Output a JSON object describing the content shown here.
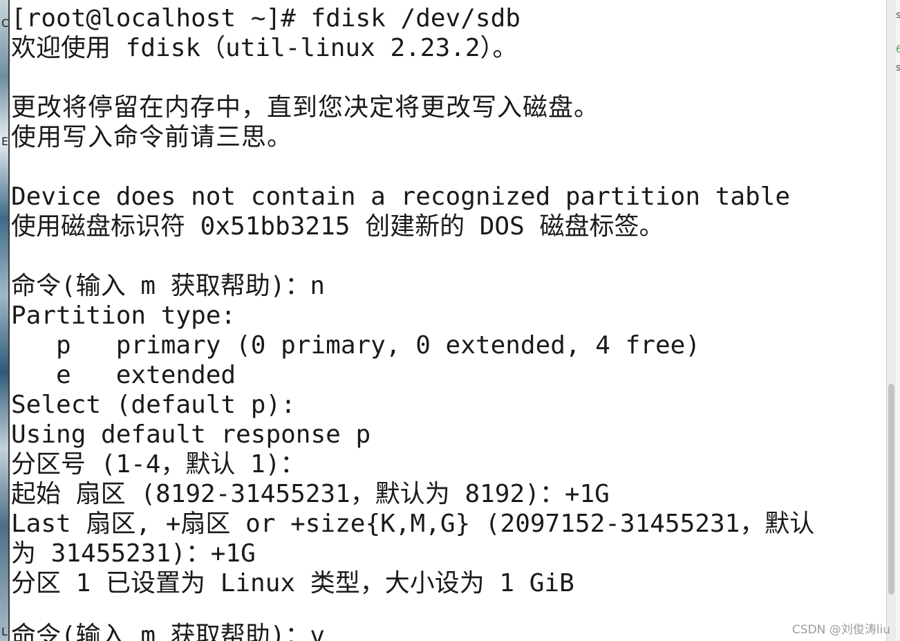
{
  "terminal": {
    "lines": [
      "[root@localhost ~]# fdisk /dev/sdb",
      "欢迎使用 fdisk（util-linux 2.23.2）。",
      "",
      "更改将停留在内存中，直到您决定将更改写入磁盘。",
      "使用写入命令前请三思。",
      "",
      "Device does not contain a recognized partition table",
      "使用磁盘标识符 0x51bb3215 创建新的 DOS 磁盘标签。",
      "",
      "命令(输入 m 获取帮助)：n",
      "Partition type:",
      "   p   primary (0 primary, 0 extended, 4 free)",
      "   e   extended",
      "Select (default p):",
      "Using default response p",
      "分区号 (1-4，默认 1)：",
      "起始 扇区 (8192-31455231，默认为 8192)：+1G",
      "Last 扇区, +扇区 or +size{K,M,G} (2097152-31455231，默认",
      "为 31455231)：+1G",
      "分区 1 已设置为 Linux 类型，大小设为 1 GiB",
      "",
      "命令(输入 m 获取帮助)：v"
    ]
  },
  "edge_left": {
    "top_char": "C",
    "mid_char": "E",
    "bottom_char": "L"
  },
  "edge_right": {
    "chars": [
      "s",
      "6",
      "s"
    ]
  },
  "watermark": "CSDN @刘俊涛liu",
  "colors": {
    "terminal_bg": "#ffffff",
    "terminal_text": "#1a1a1a",
    "watermark": "#9c9c9c",
    "accent_green": "#3fa33f"
  }
}
